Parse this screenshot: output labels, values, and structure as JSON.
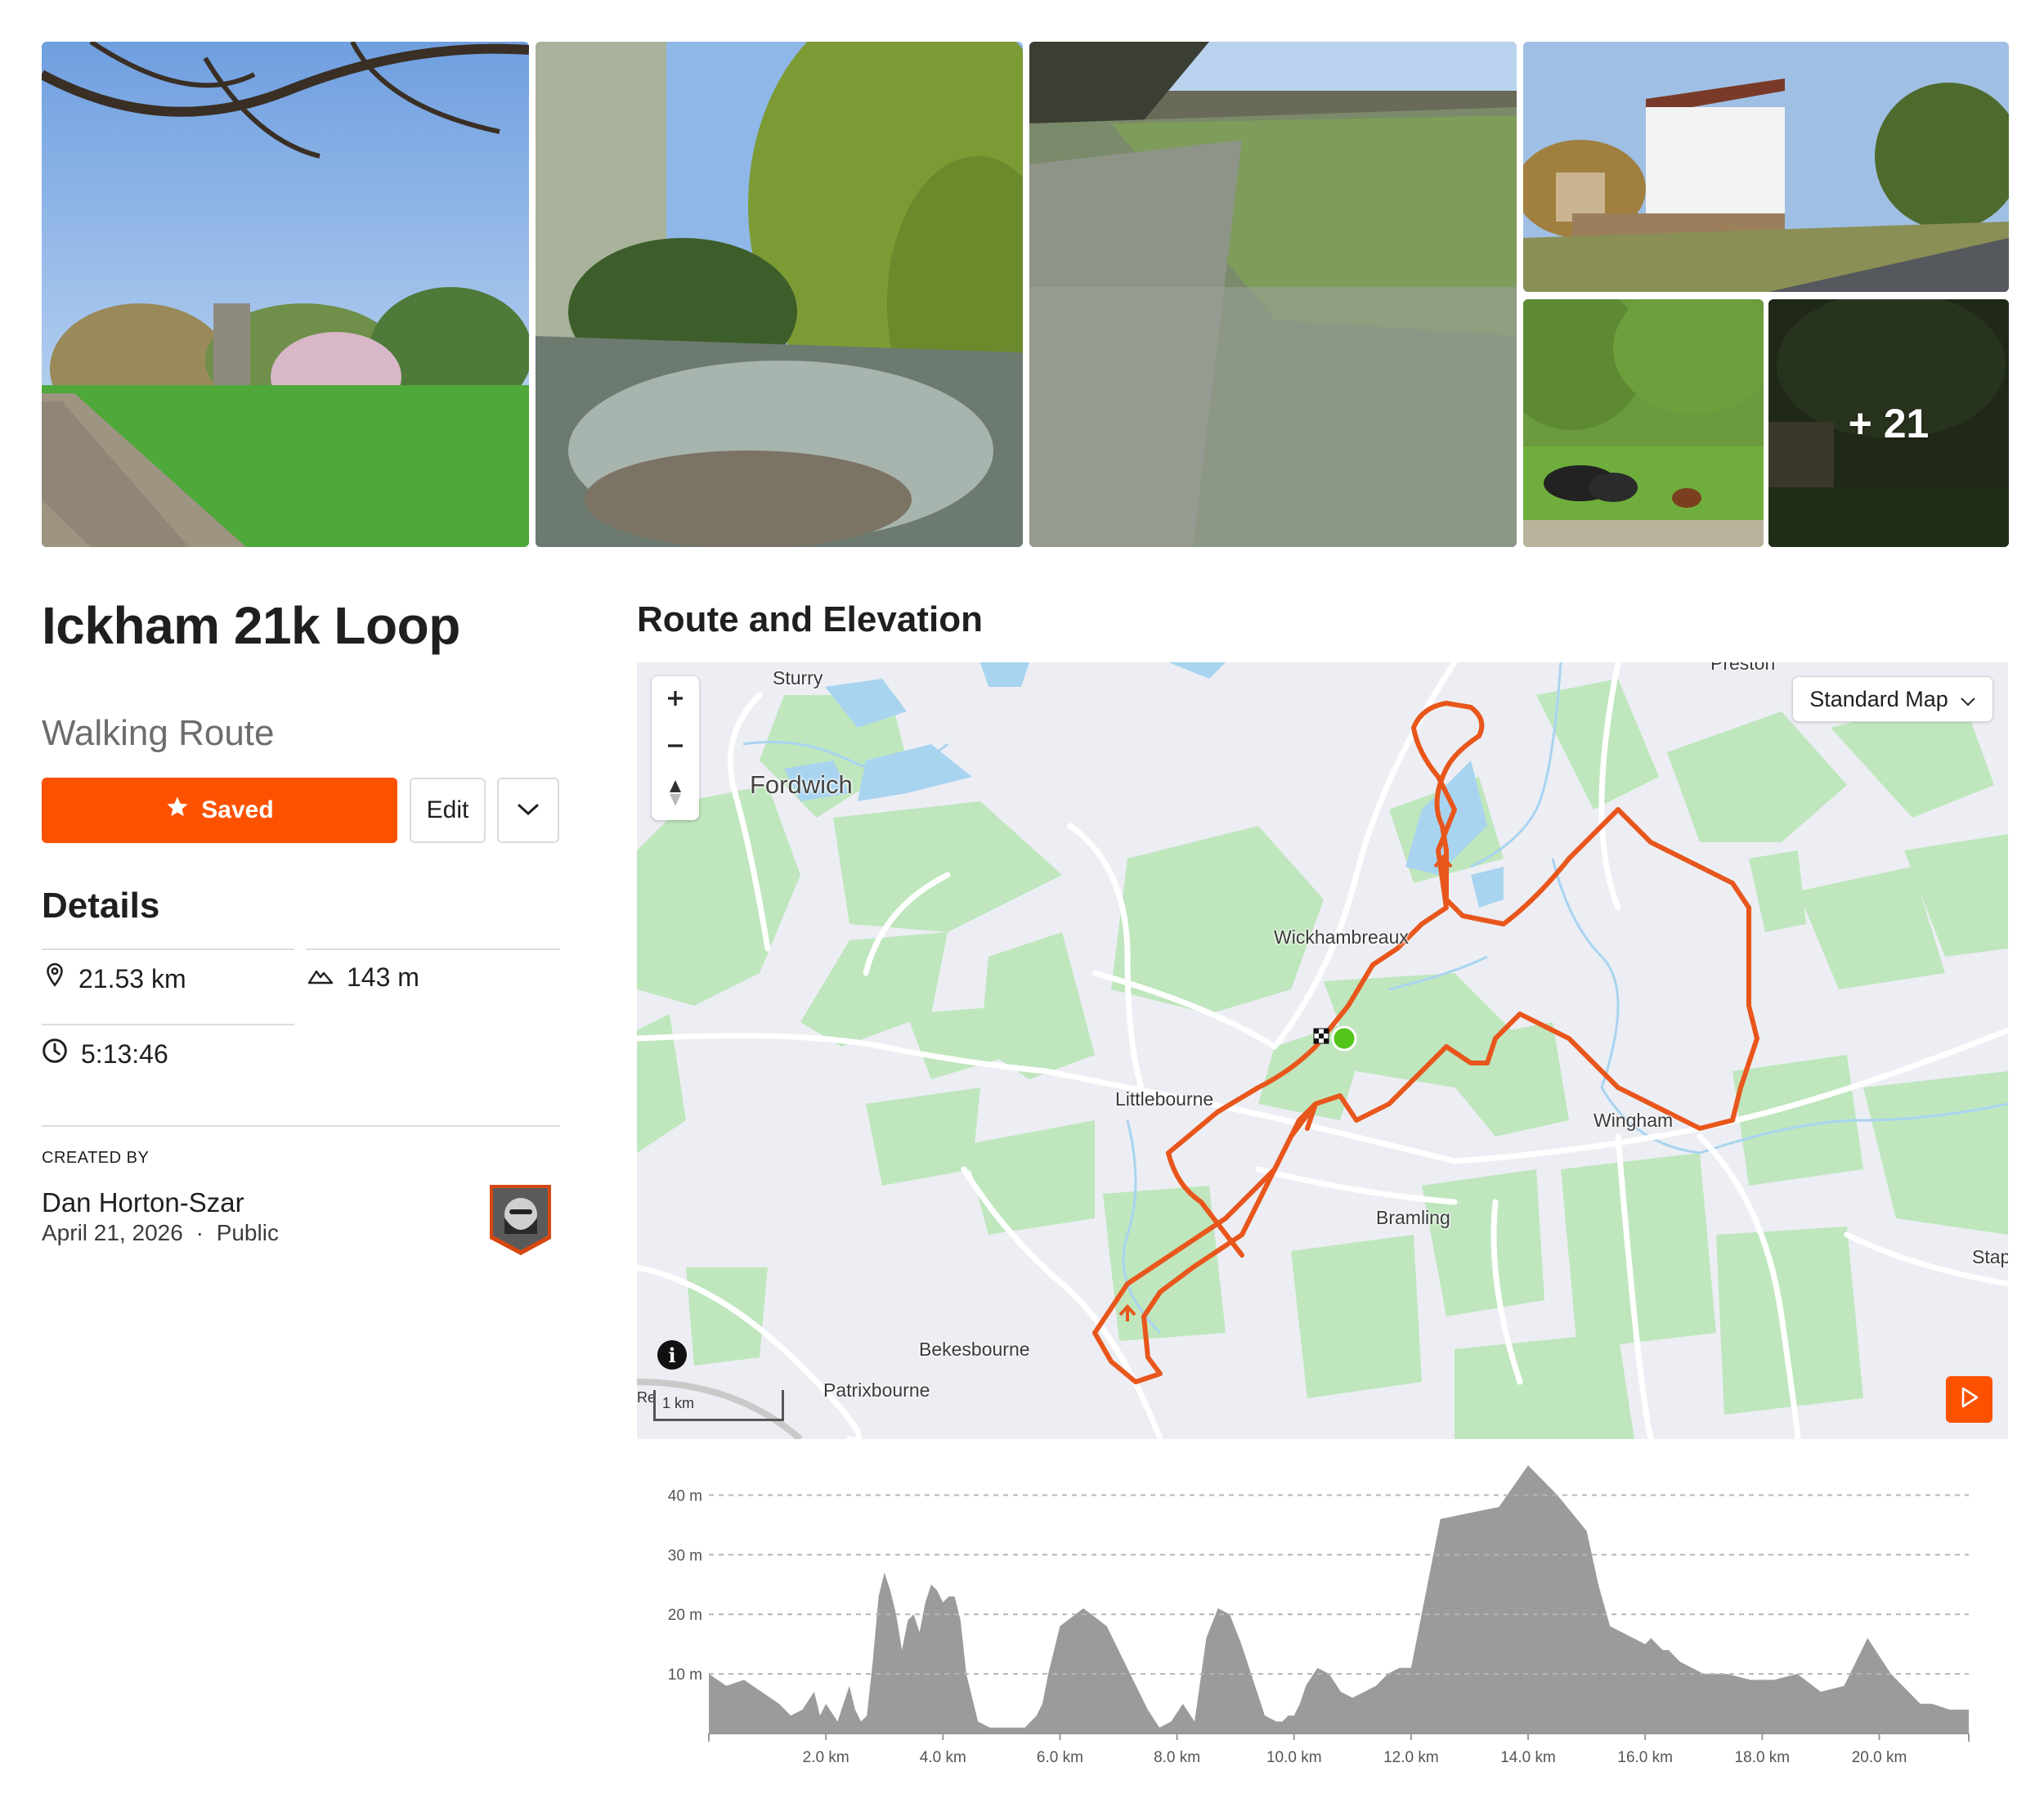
{
  "gallery": {
    "photos": [
      "tree-lined path with church",
      "river with weeping willow",
      "frosty meadow",
      "white mill building",
      "cattle in field",
      "churchyard"
    ],
    "more_count": "+ 21"
  },
  "route": {
    "title": "Ickham 21k Loop",
    "type": "Walking Route"
  },
  "actions": {
    "saved_label": "Saved",
    "edit_label": "Edit"
  },
  "details": {
    "heading": "Details",
    "distance": "21.53 km",
    "elevation_gain": "143 m",
    "time": "5:13:46"
  },
  "creator": {
    "label": "CREATED BY",
    "name": "Dan Horton-Szar",
    "date": "April 21, 2026",
    "separator": "·",
    "visibility": "Public"
  },
  "map": {
    "heading": "Route and Elevation",
    "style_label": "Standard Map",
    "scale_label": "1 km",
    "scale_cut_label": "Re",
    "info_label": "i",
    "places": {
      "sturry": "Sturry",
      "preston": "Preston",
      "fordwich": "Fordwich",
      "wickhambreaux": "Wickhambreaux",
      "littlebourne": "Littlebourne",
      "wingham": "Wingham",
      "bramling": "Bramling",
      "stap": "Stap",
      "bekesbourne": "Bekesbourne",
      "patrixbourne": "Patrixbourne"
    },
    "colors": {
      "route": "#e8561c",
      "start": "#52c41a",
      "green": "#bfe6bd",
      "water": "#a8d4f0",
      "road": "#ffffff"
    }
  },
  "chart_data": {
    "type": "area",
    "title": "",
    "xlabel": "",
    "ylabel": "",
    "x_unit": "km",
    "xlim": [
      0,
      21.53
    ],
    "ylim": [
      0,
      45
    ],
    "y_ticks": [
      10,
      20,
      30,
      40
    ],
    "y_tick_labels": [
      "10 m",
      "20 m",
      "30 m",
      "40 m"
    ],
    "x_ticks": [
      2,
      4,
      6,
      8,
      10,
      12,
      14,
      16,
      18,
      20
    ],
    "x_tick_labels": [
      "2.0 km",
      "4.0 km",
      "6.0 km",
      "8.0 km",
      "10.0 km",
      "12.0 km",
      "14.0 km",
      "16.0 km",
      "18.0 km",
      "20.0 km"
    ],
    "grid": "horizontal dashed",
    "color": "#9b9b9b",
    "x": [
      0,
      0.3,
      0.6,
      0.9,
      1.2,
      1.4,
      1.6,
      1.8,
      1.9,
      2.0,
      2.2,
      2.4,
      2.5,
      2.6,
      2.7,
      2.8,
      2.9,
      3.0,
      3.1,
      3.2,
      3.3,
      3.4,
      3.5,
      3.6,
      3.7,
      3.8,
      3.9,
      4.0,
      4.1,
      4.2,
      4.3,
      4.4,
      4.6,
      4.8,
      5.0,
      5.2,
      5.4,
      5.5,
      5.6,
      5.7,
      5.8,
      6.0,
      6.4,
      6.8,
      7.2,
      7.5,
      7.7,
      7.9,
      8.1,
      8.3,
      8.5,
      8.7,
      8.9,
      9.1,
      9.3,
      9.5,
      9.7,
      9.8,
      9.9,
      10.0,
      10.1,
      10.2,
      10.4,
      10.6,
      10.8,
      11.0,
      11.2,
      11.4,
      11.6,
      11.8,
      12.0,
      12.5,
      13.0,
      13.5,
      14.0,
      14.5,
      15.0,
      15.2,
      15.4,
      15.6,
      15.8,
      16.0,
      16.1,
      16.2,
      16.3,
      16.4,
      16.5,
      16.6,
      16.8,
      17.0,
      17.4,
      17.8,
      18.2,
      18.6,
      19.0,
      19.4,
      19.8,
      20.2,
      20.5,
      20.7,
      20.9,
      21.2,
      21.53
    ],
    "y": [
      10,
      8,
      9,
      7,
      5,
      3,
      4,
      7,
      3,
      5,
      2,
      8,
      4,
      2,
      3,
      12,
      23,
      27,
      24,
      20,
      14,
      19,
      20,
      17,
      22,
      25,
      24,
      22,
      23,
      23,
      19,
      10,
      2,
      1,
      1,
      1,
      1,
      2,
      3,
      5,
      10,
      18,
      21,
      18,
      10,
      4,
      1,
      2,
      5,
      2,
      16,
      21,
      20,
      15,
      9,
      3,
      2,
      2,
      3,
      3,
      5,
      8,
      11,
      10,
      7,
      6,
      7,
      8,
      10,
      11,
      11,
      36,
      37,
      38,
      45,
      40,
      34,
      25,
      18,
      17,
      16,
      15,
      16,
      15,
      14,
      14,
      13,
      12,
      11,
      10,
      10,
      9,
      9,
      10,
      7,
      8,
      16,
      10,
      7,
      5,
      5,
      4,
      4
    ]
  }
}
